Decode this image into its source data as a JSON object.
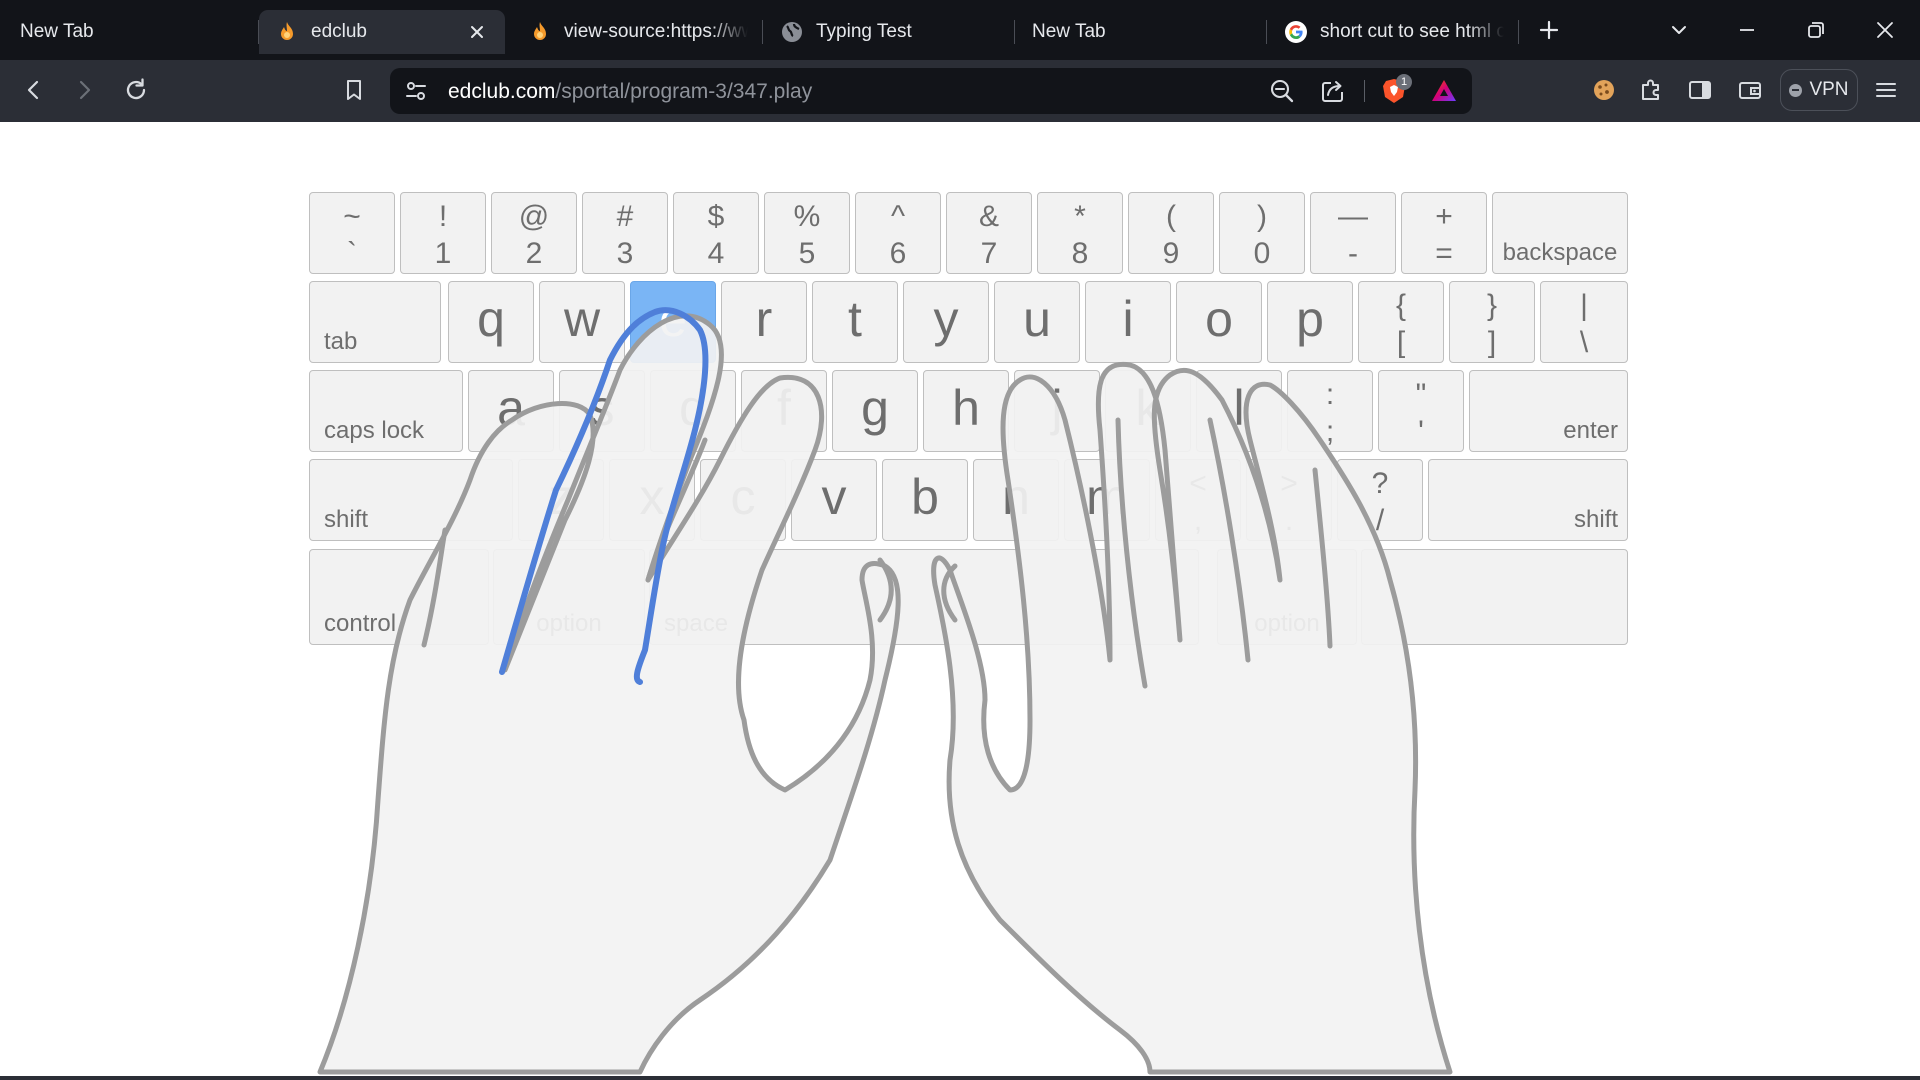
{
  "browser": {
    "tabs": [
      {
        "title": "New Tab",
        "favicon": "none",
        "active": false
      },
      {
        "title": "edclub",
        "favicon": "edclub-flame-icon",
        "active": true
      },
      {
        "title": "view-source:https://ww",
        "favicon": "edclub-flame-icon",
        "active": false
      },
      {
        "title": "Typing Test",
        "favicon": "globe-icon",
        "active": false
      },
      {
        "title": "New Tab",
        "favicon": "none",
        "active": false
      },
      {
        "title": "short cut to see html cc",
        "favicon": "google-g-icon",
        "active": false
      }
    ],
    "url": {
      "host": "edclub.com",
      "path": "/sportal/program-3/347.play"
    },
    "shields_badge": "1",
    "vpn_label": "VPN",
    "colors": {
      "tab_strip": "#121419",
      "toolbar": "#2b2e36",
      "omnibox": "#121419",
      "brave_orange": "#fb542b"
    }
  },
  "keyboard": {
    "active_key": "e",
    "active_color": "#7ab5f5",
    "rows": [
      [
        {
          "top": "~",
          "bottom": "`"
        },
        {
          "top": "!",
          "bottom": "1"
        },
        {
          "top": "@",
          "bottom": "2"
        },
        {
          "top": "#",
          "bottom": "3"
        },
        {
          "top": "$",
          "bottom": "4"
        },
        {
          "top": "%",
          "bottom": "5"
        },
        {
          "top": "^",
          "bottom": "6"
        },
        {
          "top": "&",
          "bottom": "7"
        },
        {
          "top": "*",
          "bottom": "8"
        },
        {
          "top": "(",
          "bottom": "9"
        },
        {
          "top": ")",
          "bottom": "0"
        },
        {
          "top": "—",
          "bottom": "-"
        },
        {
          "top": "+",
          "bottom": "="
        },
        {
          "word": "backspace",
          "align": "center"
        }
      ],
      [
        {
          "word": "tab",
          "align": "left"
        },
        {
          "char": "q"
        },
        {
          "char": "w"
        },
        {
          "char": "e"
        },
        {
          "char": "r"
        },
        {
          "char": "t"
        },
        {
          "char": "y"
        },
        {
          "char": "u"
        },
        {
          "char": "i"
        },
        {
          "char": "o"
        },
        {
          "char": "p"
        },
        {
          "top": "{",
          "bottom": "["
        },
        {
          "top": "}",
          "bottom": "]"
        },
        {
          "top": "|",
          "bottom": "\\"
        }
      ],
      [
        {
          "word": "caps lock",
          "align": "left"
        },
        {
          "char": "a"
        },
        {
          "char": "s"
        },
        {
          "char": "d"
        },
        {
          "char": "f"
        },
        {
          "char": "g"
        },
        {
          "char": "h"
        },
        {
          "char": "j"
        },
        {
          "char": "k"
        },
        {
          "char": "l"
        },
        {
          "top": ":",
          "bottom": ";"
        },
        {
          "top": "\"",
          "bottom": "'"
        },
        {
          "word": "enter",
          "align": "right"
        }
      ],
      [
        {
          "word": "shift",
          "align": "left"
        },
        {
          "char": "z"
        },
        {
          "char": "x"
        },
        {
          "char": "c"
        },
        {
          "char": "v"
        },
        {
          "char": "b"
        },
        {
          "char": "n"
        },
        {
          "char": "m"
        },
        {
          "top": "<",
          "bottom": ","
        },
        {
          "top": ">",
          "bottom": "."
        },
        {
          "top": "?",
          "bottom": "/"
        },
        {
          "word": "shift",
          "align": "right"
        }
      ],
      [
        {
          "word": "control",
          "align": "left"
        },
        {
          "word": "option",
          "align": "center"
        },
        {
          "word": "space",
          "align": "left"
        },
        {
          "word": "option",
          "align": "center"
        },
        {
          "word": "",
          "align": "center"
        }
      ]
    ]
  }
}
